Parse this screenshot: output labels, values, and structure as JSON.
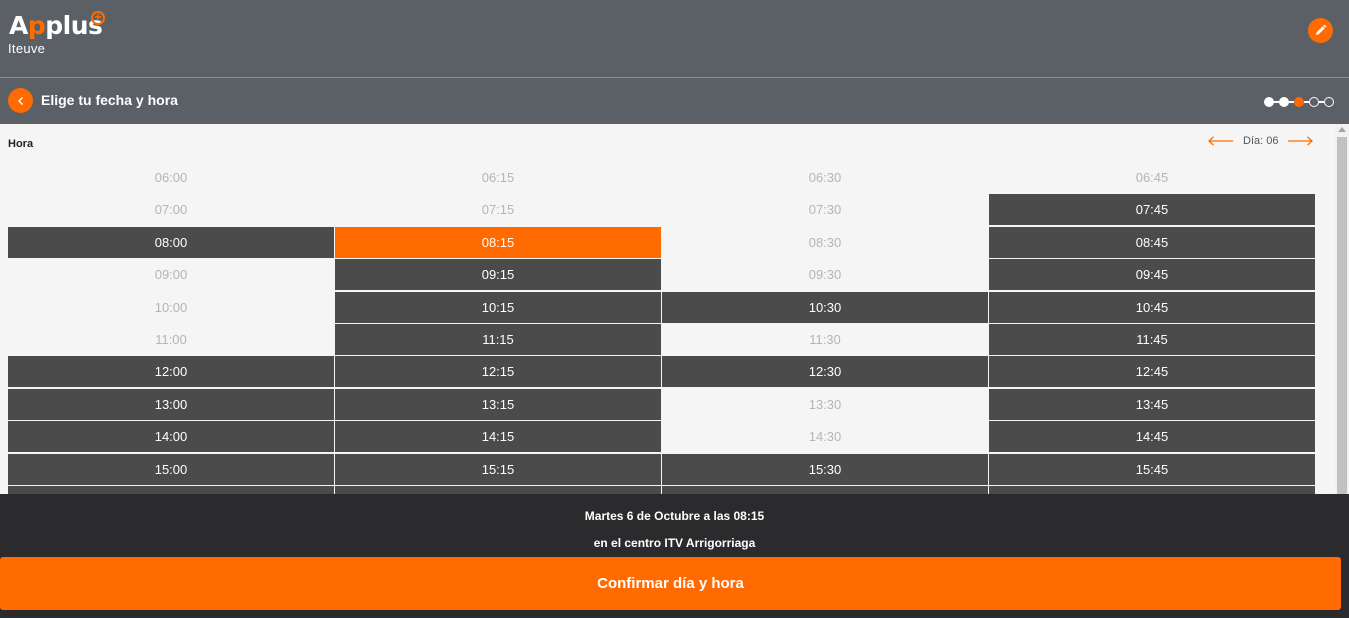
{
  "header": {
    "brand_pre": "A",
    "brand_mid": "p",
    "brand_post": "plus",
    "brand_sub": "Iteuve",
    "edit_icon": "pencil-icon"
  },
  "subheader": {
    "title": "Elige tu fecha y hora",
    "back_icon": "chevron-left-icon",
    "steps_total": 5,
    "steps_current": 3
  },
  "schedule": {
    "hora_label": "Hora",
    "day_label": "Día: 06",
    "columns": [
      [
        {
          "t": "06:00",
          "s": "na"
        },
        {
          "t": "07:00",
          "s": "na"
        },
        {
          "t": "08:00",
          "s": "av"
        },
        {
          "t": "09:00",
          "s": "na"
        },
        {
          "t": "10:00",
          "s": "na"
        },
        {
          "t": "11:00",
          "s": "na"
        },
        {
          "t": "12:00",
          "s": "av"
        },
        {
          "t": "13:00",
          "s": "av"
        },
        {
          "t": "14:00",
          "s": "av"
        },
        {
          "t": "15:00",
          "s": "av"
        },
        {
          "t": "",
          "s": "av"
        }
      ],
      [
        {
          "t": "06:15",
          "s": "na"
        },
        {
          "t": "07:15",
          "s": "na"
        },
        {
          "t": "08:15",
          "s": "sel"
        },
        {
          "t": "09:15",
          "s": "av"
        },
        {
          "t": "10:15",
          "s": "av"
        },
        {
          "t": "11:15",
          "s": "av"
        },
        {
          "t": "12:15",
          "s": "av"
        },
        {
          "t": "13:15",
          "s": "av"
        },
        {
          "t": "14:15",
          "s": "av"
        },
        {
          "t": "15:15",
          "s": "av"
        },
        {
          "t": "",
          "s": "av"
        }
      ],
      [
        {
          "t": "06:30",
          "s": "na"
        },
        {
          "t": "07:30",
          "s": "na"
        },
        {
          "t": "08:30",
          "s": "na"
        },
        {
          "t": "09:30",
          "s": "na"
        },
        {
          "t": "10:30",
          "s": "av"
        },
        {
          "t": "11:30",
          "s": "na"
        },
        {
          "t": "12:30",
          "s": "av"
        },
        {
          "t": "13:30",
          "s": "na"
        },
        {
          "t": "14:30",
          "s": "na"
        },
        {
          "t": "15:30",
          "s": "av"
        },
        {
          "t": "",
          "s": "av"
        }
      ],
      [
        {
          "t": "06:45",
          "s": "na"
        },
        {
          "t": "07:45",
          "s": "av"
        },
        {
          "t": "08:45",
          "s": "av"
        },
        {
          "t": "09:45",
          "s": "av"
        },
        {
          "t": "10:45",
          "s": "av"
        },
        {
          "t": "11:45",
          "s": "av"
        },
        {
          "t": "12:45",
          "s": "av"
        },
        {
          "t": "13:45",
          "s": "av"
        },
        {
          "t": "14:45",
          "s": "av"
        },
        {
          "t": "15:45",
          "s": "av"
        },
        {
          "t": "",
          "s": "av"
        }
      ]
    ]
  },
  "footer": {
    "summary_line1": "Martes 6 de Octubre a las 08:15",
    "summary_line2": "en el centro ITV Arrigorriaga",
    "confirm_label": "Confirmar día y hora"
  },
  "colors": {
    "accent": "#ff6b00",
    "header_bg": "#5b6067",
    "slot_available": "#4b4b4b",
    "footer_bg": "#2b2b2d"
  }
}
